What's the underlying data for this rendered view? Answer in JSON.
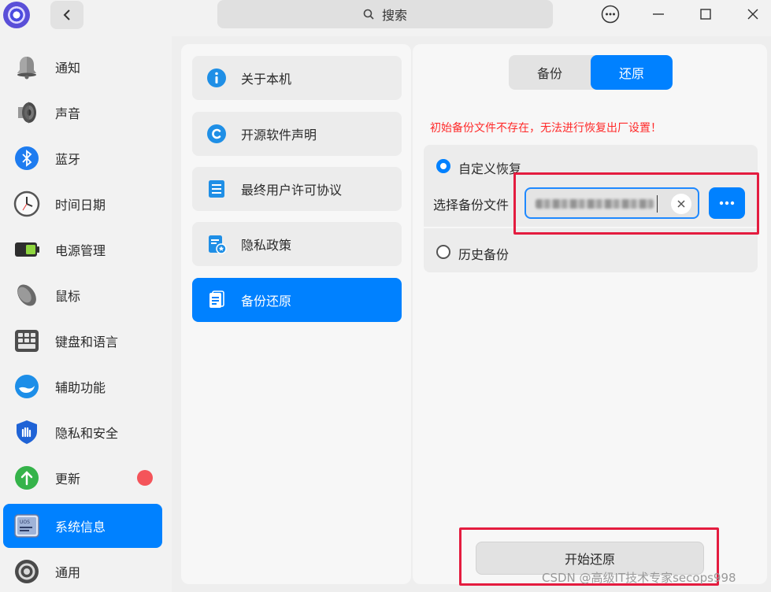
{
  "titlebar": {
    "search_placeholder": "搜索",
    "icons": {
      "logo": "app-logo-icon",
      "back": "chevron-left-icon",
      "search": "search-icon",
      "menu": "more-icon",
      "minimize": "minimize-icon",
      "maximize": "maximize-icon",
      "close": "close-icon"
    }
  },
  "sidebar": {
    "items": [
      {
        "label": "通知",
        "icon": "bell-icon"
      },
      {
        "label": "声音",
        "icon": "speaker-icon"
      },
      {
        "label": "蓝牙",
        "icon": "bluetooth-icon"
      },
      {
        "label": "时间日期",
        "icon": "clock-icon"
      },
      {
        "label": "电源管理",
        "icon": "battery-icon"
      },
      {
        "label": "鼠标",
        "icon": "mouse-icon"
      },
      {
        "label": "键盘和语言",
        "icon": "keyboard-icon"
      },
      {
        "label": "辅助功能",
        "icon": "accessibility-icon"
      },
      {
        "label": "隐私和安全",
        "icon": "shield-icon"
      },
      {
        "label": "更新",
        "icon": "update-arrow-icon"
      },
      {
        "label": "系统信息",
        "icon": "uos-system-info-icon"
      },
      {
        "label": "通用",
        "icon": "gear-icon"
      }
    ],
    "active_index": 10,
    "update_badge_color": "#f4545a"
  },
  "system_info": {
    "items": [
      {
        "label": "关于本机",
        "icon": "info-icon"
      },
      {
        "label": "开源软件声明",
        "icon": "copyright-icon"
      },
      {
        "label": "最终用户许可协议",
        "icon": "document-icon"
      },
      {
        "label": "隐私政策",
        "icon": "privacy-policy-icon"
      },
      {
        "label": "备份还原",
        "icon": "backup-icon"
      }
    ],
    "active_index": 4
  },
  "backup_restore": {
    "tabs": [
      {
        "label": "备份"
      },
      {
        "label": "还原"
      }
    ],
    "active_tab": 1,
    "warning": "初始备份文件不存在，无法进行恢复出厂设置！",
    "options": {
      "custom_restore": "自定义恢复",
      "history_backup": "历史备份",
      "selected": "custom_restore"
    },
    "file_label": "选择备份文件",
    "file_value_obscured": true,
    "start_button": "开始还原"
  },
  "colors": {
    "accent": "#0081ff",
    "warning": "#ff2a2a",
    "highlight": "#e41c3f"
  },
  "watermark": "CSDN @高级IT技术专家secops998"
}
